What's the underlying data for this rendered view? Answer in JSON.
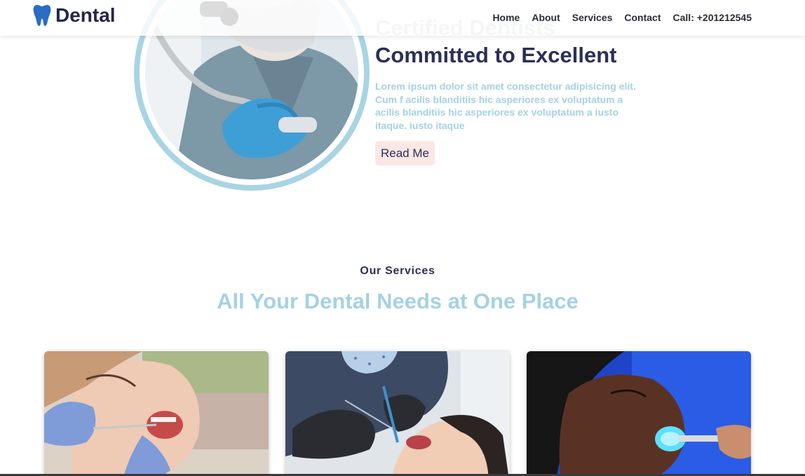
{
  "navbar": {
    "brand": "Dental",
    "brand_icon": "tooth-icon",
    "links": [
      "Home",
      "About",
      "Services",
      "Contact",
      "Call: +201212545"
    ]
  },
  "hero": {
    "kicker": "Certified Dentists",
    "title": "Committed to Excellent",
    "body": "Lorem ipsum dolor sit amet consectetur adipisicing elit. Cum f acilis blanditiis hic asperiores ex voluptatum a acilis blanditiis hic asperiores ex voluptatum a iusto itaque. iusto itaque",
    "button": "Read Me",
    "image": "dentist-with-drill-photo"
  },
  "services": {
    "kicker": "Our Services",
    "title": "All Your Dental Needs at One Place",
    "cards": [
      {
        "image": "patient-dental-exam-photo"
      },
      {
        "image": "dentist-treating-patient-photo"
      },
      {
        "image": "blue-light-whitening-photo"
      }
    ]
  },
  "colors": {
    "brand_blue": "#2b6cc4",
    "navy": "#2c2f58",
    "light_blue": "#a4d2e2",
    "button_bg": "#fbe7e3"
  }
}
